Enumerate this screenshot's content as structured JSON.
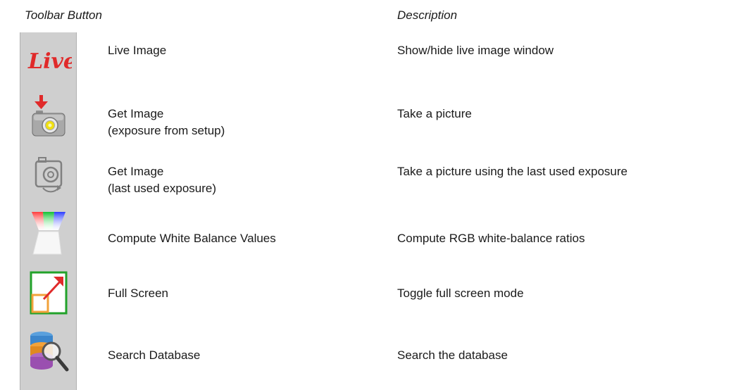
{
  "header": {
    "col_button": "Toolbar Button",
    "col_description": "Description"
  },
  "rows": [
    {
      "icon": "live-icon",
      "label1": "Live Image",
      "label2": "",
      "description": "Show/hide live image window",
      "live_text": "Live"
    },
    {
      "icon": "camera-download-icon",
      "label1": "Get Image",
      "label2": "(exposure from setup)",
      "description": "Take a picture"
    },
    {
      "icon": "camera-outline-icon",
      "label1": "Get Image",
      "label2": "(last used exposure)",
      "description": "Take a picture using the last used exposure"
    },
    {
      "icon": "white-balance-icon",
      "label1": "Compute White Balance Values",
      "label2": "",
      "description": "Compute RGB white-balance ratios"
    },
    {
      "icon": "full-screen-icon",
      "label1": "Full Screen",
      "label2": "",
      "description": "Toggle full screen mode"
    },
    {
      "icon": "search-database-icon",
      "label1": "Search Database",
      "label2": "",
      "description": "Search the database"
    }
  ],
  "colors": {
    "toolbar_bg": "#cfcfcf",
    "live_red": "#e02a2a",
    "fullscreen_green": "#22a22a",
    "fullscreen_orange": "#f2a23a"
  }
}
